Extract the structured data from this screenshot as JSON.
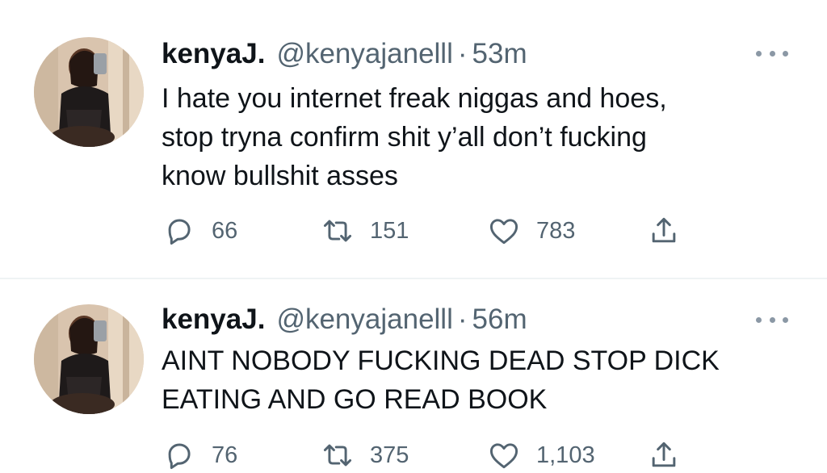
{
  "tweets": [
    {
      "display_name": "kenyaJ.",
      "handle": "@kenyajanelll",
      "separator": "·",
      "time": "53m",
      "text_lines": [
        "I hate you internet freak niggas and hoes,",
        "stop tryna confirm shit y’all don’t fucking",
        "know bullshit asses"
      ],
      "replies": "66",
      "retweets": "151",
      "likes": "783",
      "icons": {
        "more": "more-dots-icon",
        "reply": "reply-bubble-icon",
        "retweet": "retweet-icon",
        "like": "heart-icon",
        "share": "share-icon"
      }
    },
    {
      "display_name": "kenyaJ.",
      "handle": "@kenyajanelll",
      "separator": "·",
      "time": "56m",
      "text_lines": [
        "AINT NOBODY FUCKING DEAD STOP DICK",
        "EATING AND GO READ BOOK"
      ],
      "replies": "76",
      "retweets": "375",
      "likes": "1,103",
      "icons": {
        "more": "more-dots-icon",
        "reply": "reply-bubble-icon",
        "retweet": "retweet-icon",
        "like": "heart-icon",
        "share": "share-icon"
      }
    }
  ],
  "colors": {
    "text_primary": "#0f1419",
    "text_secondary": "#536471",
    "icon": "#536471",
    "divider": "#eff3f4"
  }
}
